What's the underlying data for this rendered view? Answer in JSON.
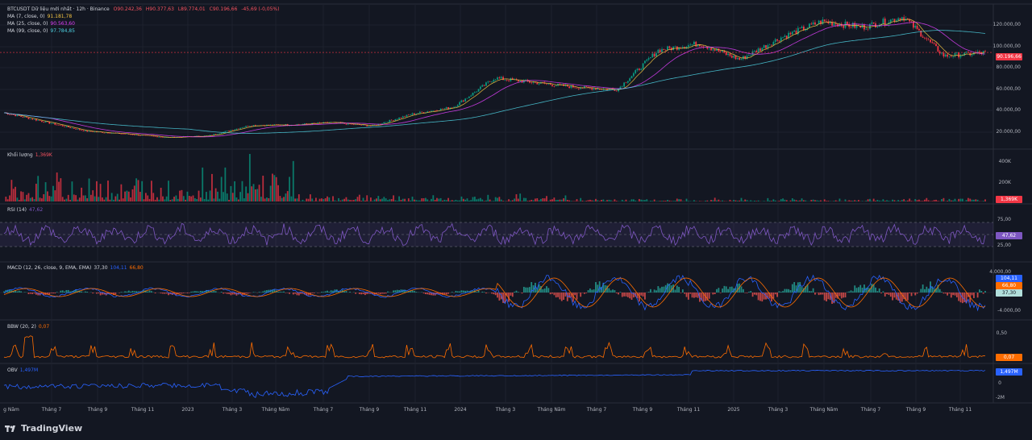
{
  "header": {
    "symbol": "BTCUSDT Dữ liệu mới nhất · 12h · Binance",
    "o": "O90.242,36",
    "h": "H90.377,63",
    "l": "L89.774,01",
    "c": "C90.196,66",
    "chg": "-45,69 (-0,05%)"
  },
  "ma_legend": [
    {
      "label": "MA (7, close, 0)",
      "value": "91.181,78",
      "color": "#f5c542"
    },
    {
      "label": "MA (25, close, 0)",
      "value": "90.563,60",
      "color": "#e040fb"
    },
    {
      "label": "MA (99, close, 0)",
      "value": "97.784,85",
      "color": "#4dd0e1"
    }
  ],
  "volume_legend": {
    "label": "Khối lượng",
    "value": "1,369K"
  },
  "rsi_legend": {
    "label": "RSI (14)",
    "value": "47,62"
  },
  "macd_legend": {
    "label": "MACD (12, 26, close, 9, EMA, EMA)",
    "v1": "37,30",
    "v2": "104,11",
    "v3": "66,80"
  },
  "bbw_legend": {
    "label": "BBW (20, 2)",
    "value": "0,07"
  },
  "obv_legend": {
    "label": "OBV",
    "value": "1,497M"
  },
  "price_axis": [
    "120.000,00",
    "100.000,00",
    "80.000,00",
    "60.000,00",
    "40.000,00",
    "20.000,00"
  ],
  "volume_axis": [
    "400K",
    "200K"
  ],
  "rsi_axis": [
    "75,00",
    "50,00",
    "25,00"
  ],
  "macd_axis": [
    "4.000,00",
    "-4.000,00"
  ],
  "bbw_axis": [
    "0,50",
    "0,25"
  ],
  "obv_axis": [
    "0",
    "-2M"
  ],
  "tags": {
    "price": "90.196,66",
    "volume": "1,369K",
    "rsi": "47,62",
    "macd1": "104,11",
    "macd2": "66,80",
    "macd3": "37,30",
    "bbw": "0,07",
    "obv": "1,497M"
  },
  "time_axis": [
    "g Năm",
    "Tháng 7",
    "Tháng 9",
    "Tháng 11",
    "2023",
    "Tháng 3",
    "Tháng Năm",
    "Tháng 7",
    "Tháng 9",
    "Tháng 11",
    "2024",
    "Tháng 3",
    "Tháng Năm",
    "Tháng 7",
    "Tháng 9",
    "Tháng 11",
    "2025",
    "Tháng 3",
    "Tháng Năm",
    "Tháng 7",
    "Tháng 9",
    "Tháng 11"
  ],
  "footer": {
    "brand": "TradingView"
  },
  "chart_data": {
    "type": "line",
    "series": [
      {
        "name": "BTCUSDT",
        "x": [
          "2022-05",
          "2022-06",
          "2022-07",
          "2022-09",
          "2022-11",
          "2023-01",
          "2023-03",
          "2023-05",
          "2023-07",
          "2023-09",
          "2023-11",
          "2024-01",
          "2024-03",
          "2024-05",
          "2024-07",
          "2024-09",
          "2024-11",
          "2025-01",
          "2025-03",
          "2025-05",
          "2025-07",
          "2025-09",
          "2025-10",
          "2025-11",
          "2025-12"
        ],
        "values": [
          38000,
          30000,
          22000,
          19500,
          16500,
          18000,
          27000,
          27500,
          29500,
          26500,
          37000,
          43000,
          68000,
          64000,
          60000,
          58000,
          92000,
          98000,
          84000,
          103000,
          117000,
          112000,
          121000,
          87000,
          90196.66
        ]
      }
    ],
    "ylim": [
      10000,
      130000
    ],
    "rsi": {
      "upper": 75,
      "middle": 50,
      "lower": 25,
      "last": 47.62
    },
    "volume_peak": 400000
  }
}
